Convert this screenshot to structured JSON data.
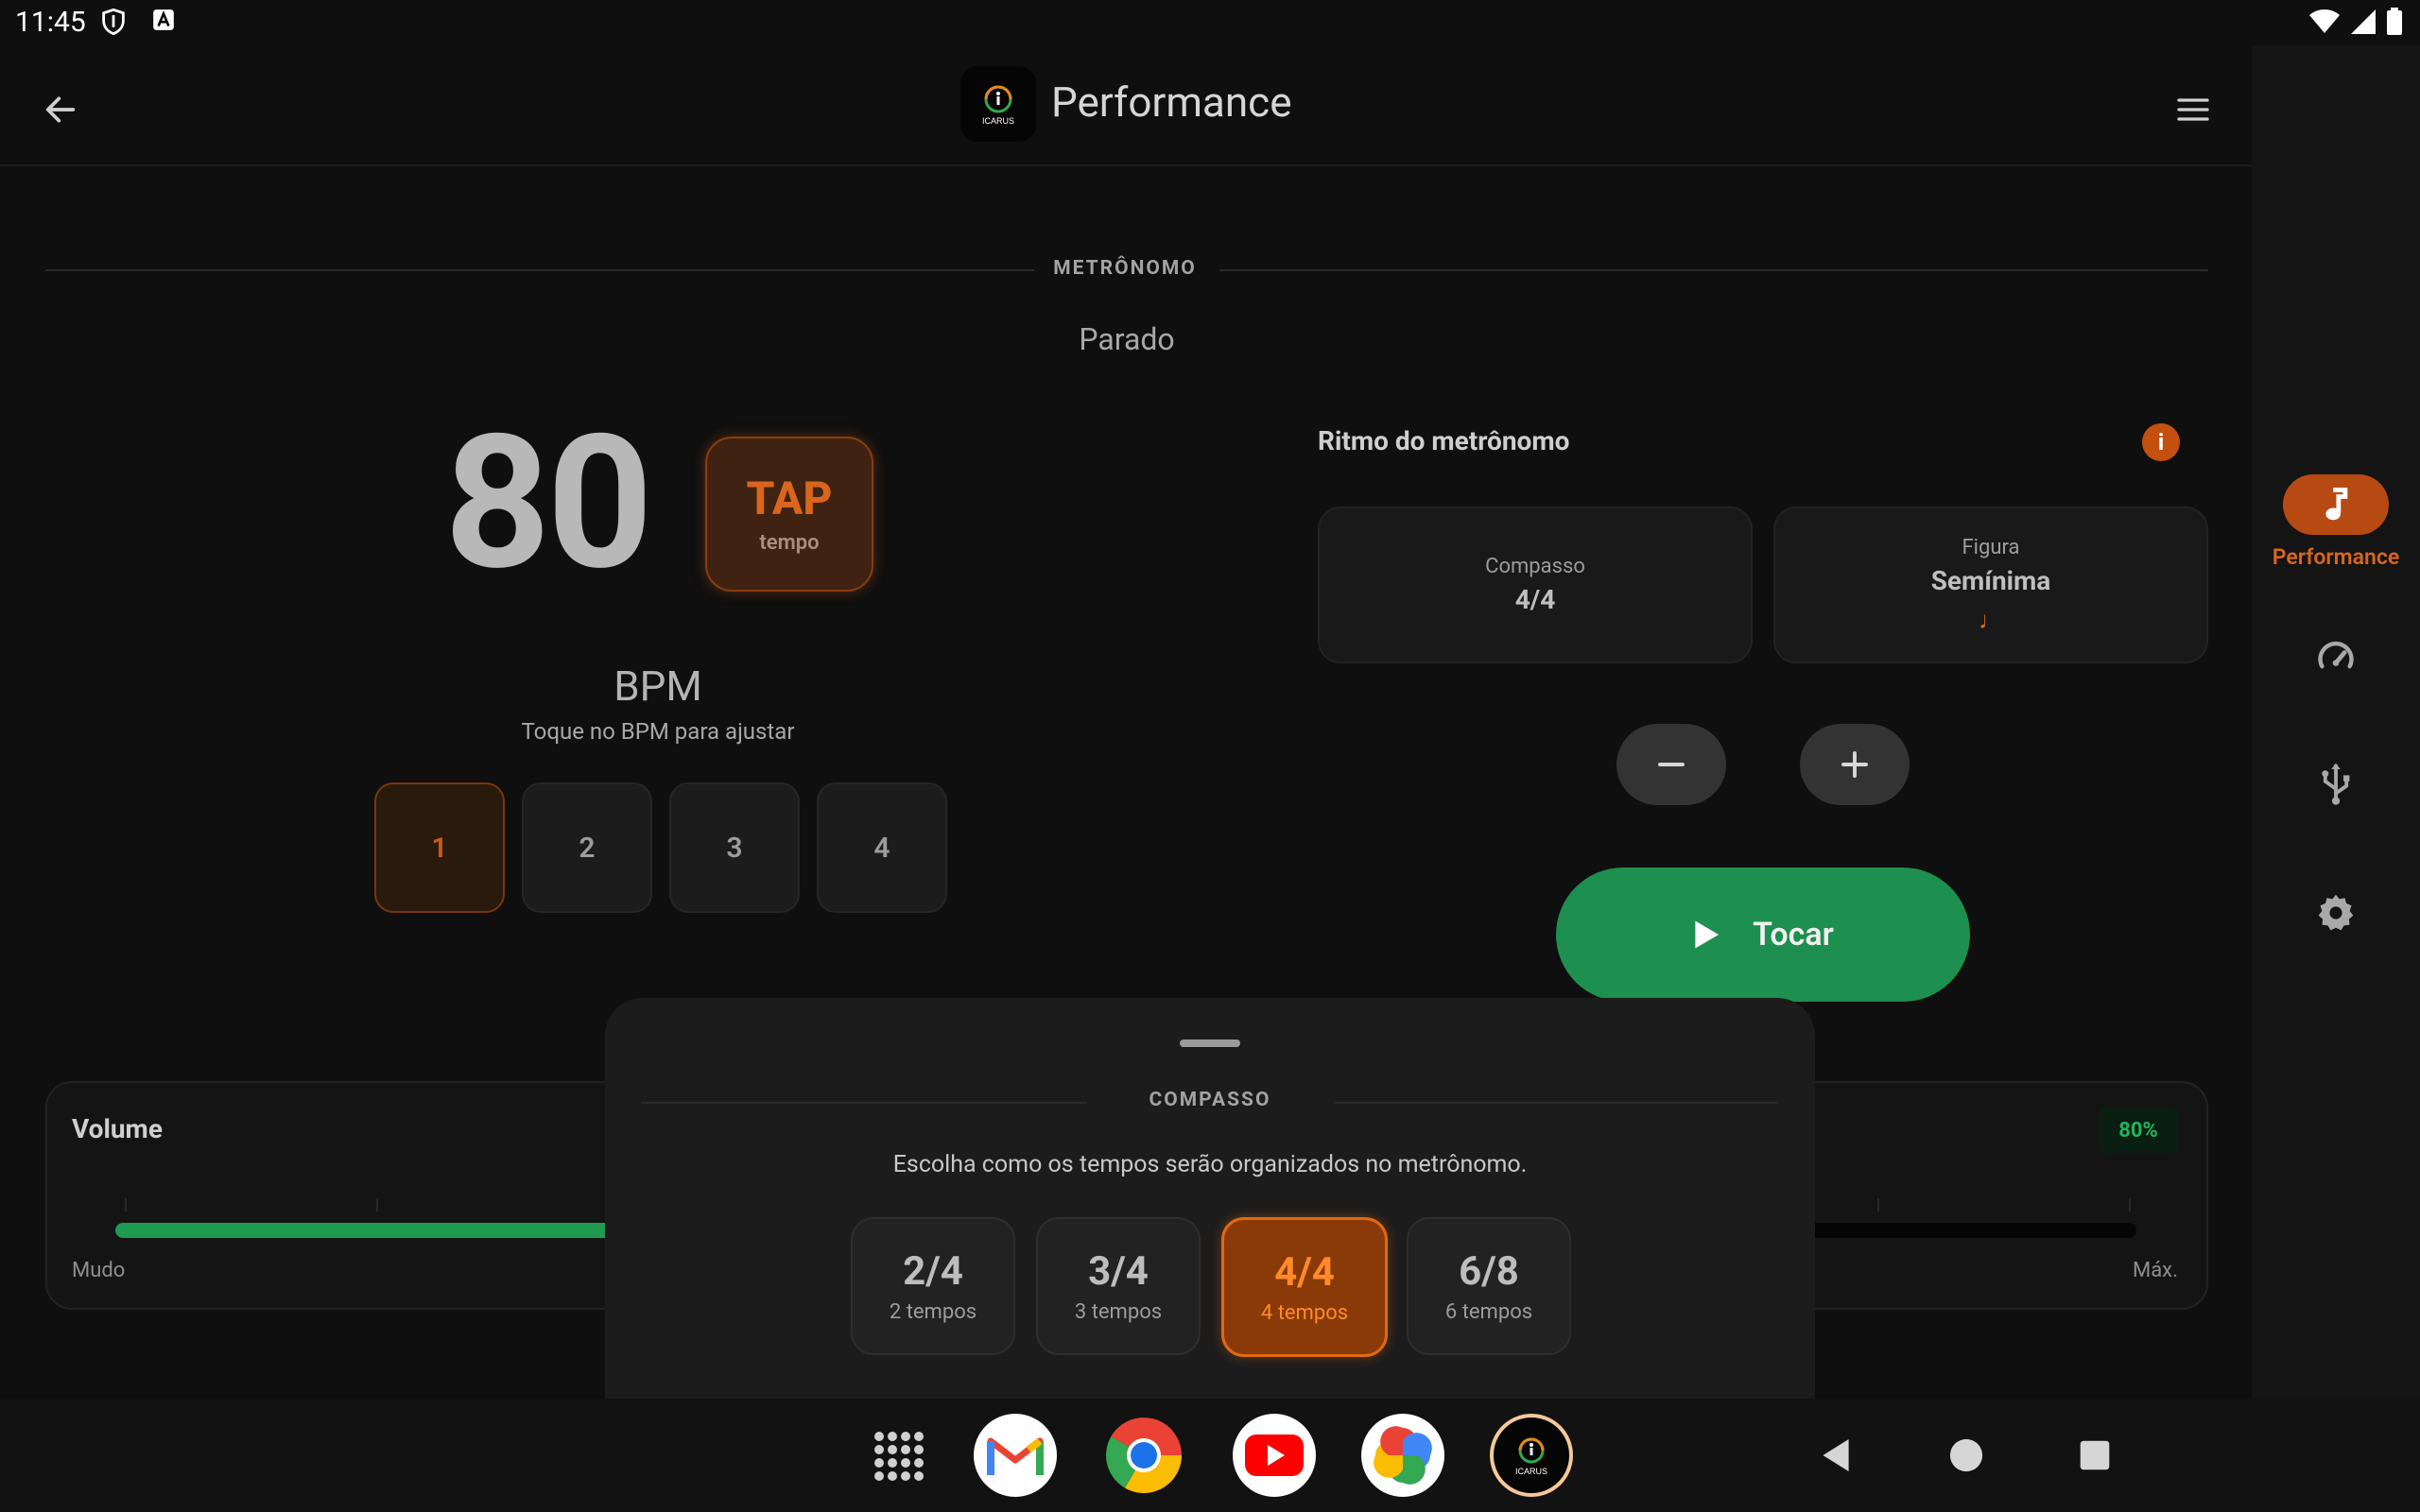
{
  "status": {
    "time": "11:45"
  },
  "header": {
    "title": "Performance",
    "logo_text": "ICARUS"
  },
  "rail": {
    "items": [
      {
        "label": "Performance",
        "icon": "music-note-icon"
      },
      {
        "icon": "speedometer-icon"
      },
      {
        "icon": "usb-icon"
      },
      {
        "icon": "settings-icon"
      }
    ]
  },
  "metronome": {
    "section_title": "METRÔNOMO",
    "state": "Parado",
    "bpm": "80",
    "tap_label": "TAP",
    "tap_sub": "tempo",
    "bpm_label": "BPM",
    "bpm_hint": "Toque no BPM para ajustar",
    "beats": [
      "1",
      "2",
      "3",
      "4"
    ],
    "active_beat": 1
  },
  "rhythm": {
    "title": "Ritmo do metrônomo",
    "compasso_label": "Compasso",
    "compasso_value": "4/4",
    "figura_label": "Figura",
    "figura_value": "Semínima",
    "figura_symbol": "♩",
    "play_label": "Tocar"
  },
  "volume": {
    "title": "Volume",
    "percent_label": "80%",
    "level": 0.8,
    "min_label": "Mudo",
    "max_label": "Máx."
  },
  "sheet": {
    "title": "COMPASSO",
    "description": "Escolha como os tempos serão organizados no metrônomo.",
    "options": [
      {
        "value": "2/4",
        "caption": "2 tempos"
      },
      {
        "value": "3/4",
        "caption": "3 tempos"
      },
      {
        "value": "4/4",
        "caption": "4 tempos",
        "selected": true
      },
      {
        "value": "6/8",
        "caption": "6 tempos"
      }
    ]
  },
  "taskbar": {
    "apps": [
      "app-drawer-icon",
      "gmail-icon",
      "chrome-icon",
      "youtube-icon",
      "photos-icon",
      "icarus-icon"
    ]
  },
  "colors": {
    "accent": "#d9661c",
    "play": "#1d8f4f",
    "volume": "#1f9a52",
    "background": "#0f0f0f"
  }
}
